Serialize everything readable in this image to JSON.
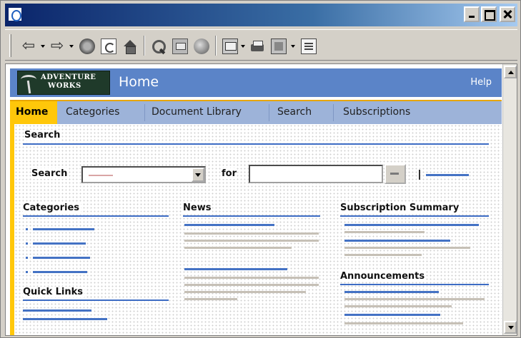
{
  "site": {
    "logo_line1": "ADVENTURE",
    "logo_line2": "WORKS",
    "page_title": "Home",
    "help_label": "Help"
  },
  "nav": {
    "items": [
      "Home",
      "Categories",
      "Document Library",
      "Search",
      "Subscriptions"
    ],
    "active": "Home"
  },
  "search": {
    "heading": "Search",
    "label": "Search",
    "for_label": "for",
    "query_value": ""
  },
  "sections": {
    "categories": "Categories",
    "news": "News",
    "subscription_summary": "Subscription Summary",
    "quick_links": "Quick Links",
    "announcements": "Announcements"
  },
  "icons": {
    "toolbar": [
      "back-icon",
      "forward-icon",
      "stop-icon",
      "refresh-icon",
      "home-icon",
      "search-icon",
      "favorites-icon",
      "history-icon",
      "mail-icon",
      "print-icon",
      "edit-icon",
      "discuss-icon"
    ]
  },
  "colors": {
    "header_blue": "#5b84c8",
    "nav_blue": "#9db3d9",
    "accent_gold": "#ffc70a",
    "link_blue": "#4472c4"
  }
}
